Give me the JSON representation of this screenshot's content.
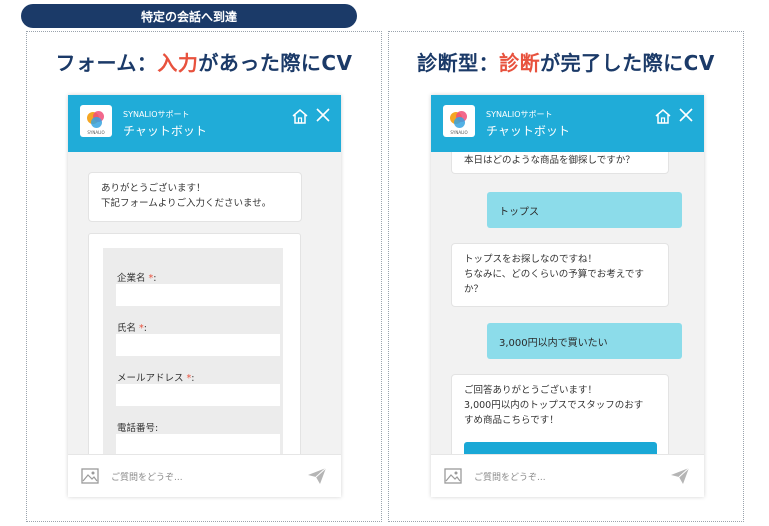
{
  "tag": "特定の会話へ到達",
  "left": {
    "heading_pre": "フォーム：",
    "heading_accent": "入力",
    "heading_post": "があった際にCV",
    "chat": {
      "bot_subtitle": "SYNALIOサポート",
      "bot_name": "チャットボット",
      "logo_text": "SYNALIO",
      "greeting_line1": "ありがとうございます！",
      "greeting_line2": "下記フォームよりご入力くださいませ。",
      "fields": [
        {
          "label": "企業名 ",
          "required": "*",
          "suffix": ":"
        },
        {
          "label": "氏名 ",
          "required": "*",
          "suffix": ":"
        },
        {
          "label": "メールアドレス ",
          "required": "*",
          "suffix": ":"
        },
        {
          "label": "電話番号:",
          "required": "",
          "suffix": ""
        }
      ],
      "input_placeholder": "ご質問をどうぞ..."
    }
  },
  "right": {
    "heading_pre": "診断型：",
    "heading_accent": "診断",
    "heading_post": "が完了した際にCV",
    "chat": {
      "bot_subtitle": "SYNALIOサポート",
      "bot_name": "チャットボット",
      "logo_text": "SYNALIO",
      "bot_msg1": "本日はどのような商品を御探しですか？",
      "user_msg1": "トップス",
      "bot_msg2_line1": "トップスをお探しなのですね！",
      "bot_msg2_line2": "ちなみに、どのくらいの予算でお考えです",
      "bot_msg2_line3": "か？",
      "user_msg2": "3,000円以内で買いたい",
      "bot_msg3_line1": "ご回答ありがとうございます！",
      "bot_msg3_line2": "3,000円以内のトップスでスタッフのおす",
      "bot_msg3_line3": "すめ商品こちらです！",
      "input_placeholder": "ご質問をどうぞ..."
    }
  },
  "colors": {
    "navy": "#1b3a68",
    "accent": "#e8523e",
    "header": "#20acd8",
    "user_bubble": "#8cdcea"
  }
}
